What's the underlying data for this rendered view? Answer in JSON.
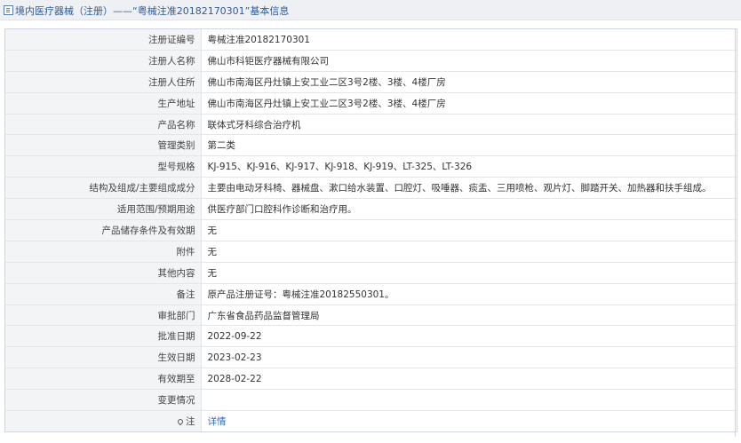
{
  "header": {
    "title": "境内医疗器械（注册）——“粤械注准20182170301”基本信息"
  },
  "rows": [
    {
      "label": "注册证编号",
      "value": "粤械注准20182170301"
    },
    {
      "label": "注册人名称",
      "value": "佛山市科钜医疗器械有限公司"
    },
    {
      "label": "注册人住所",
      "value": "佛山市南海区丹灶镇上安工业二区3号2楼、3楼、4楼厂房"
    },
    {
      "label": "生产地址",
      "value": "佛山市南海区丹灶镇上安工业二区3号2楼、3楼、4楼厂房"
    },
    {
      "label": "产品名称",
      "value": "联体式牙科综合治疗机"
    },
    {
      "label": "管理类别",
      "value": "第二类"
    },
    {
      "label": "型号规格",
      "value": "KJ-915、KJ-916、KJ-917、KJ-918、KJ-919、LT-325、LT-326"
    },
    {
      "label": "结构及组成/主要组成成分",
      "value": "主要由电动牙科椅、器械盘、漱口给水装置、口腔灯、吸唾器、痰盂、三用喷枪、观片灯、脚踏开关、加热器和扶手组成。"
    },
    {
      "label": "适用范围/预期用途",
      "value": "供医疗部门口腔科作诊断和治疗用。"
    },
    {
      "label": "产品储存条件及有效期",
      "value": "无"
    },
    {
      "label": "附件",
      "value": "无"
    },
    {
      "label": "其他内容",
      "value": "无"
    },
    {
      "label": "备注",
      "value": "原产品注册证号：粤械注准20182550301。"
    },
    {
      "label": "审批部门",
      "value": "广东省食品药品监督管理局"
    },
    {
      "label": "批准日期",
      "value": "2022-09-22"
    },
    {
      "label": "生效日期",
      "value": "2023-02-23"
    },
    {
      "label": "有效期至",
      "value": "2028-02-22"
    },
    {
      "label": "变更情况",
      "value": ""
    }
  ],
  "note_row": {
    "label": "注",
    "link": "详情",
    "icon": "pin-icon"
  }
}
